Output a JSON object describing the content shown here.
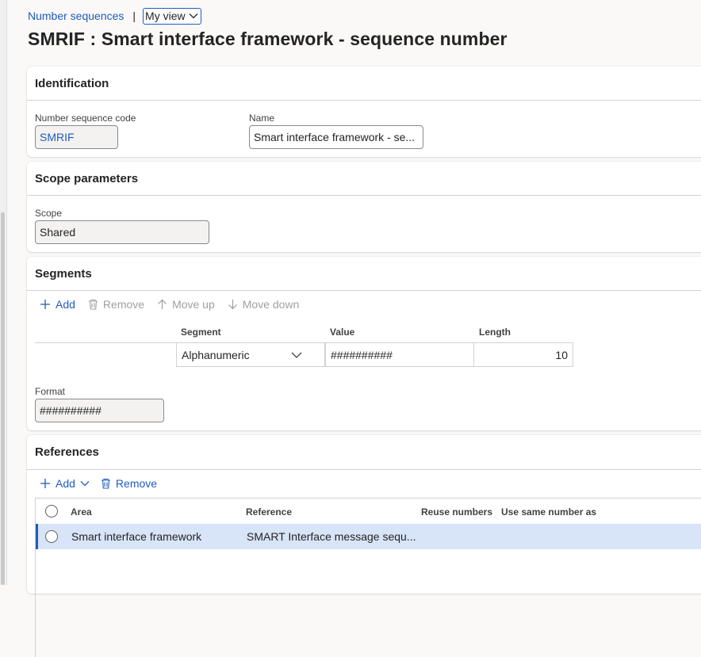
{
  "breadcrumb": {
    "link": "Number sequences",
    "separator": "|",
    "view": "My view"
  },
  "title": "SMRIF : Smart interface framework - sequence number",
  "identification": {
    "header": "Identification",
    "code_label": "Number sequence code",
    "code_value": "SMRIF",
    "name_label": "Name",
    "name_value": "Smart interface framework - se..."
  },
  "scope": {
    "header": "Scope parameters",
    "label": "Scope",
    "value": "Shared"
  },
  "segments": {
    "header": "Segments",
    "toolbar": {
      "add": "Add",
      "remove": "Remove",
      "move_up": "Move up",
      "move_down": "Move down"
    },
    "columns": {
      "segment": "Segment",
      "value": "Value",
      "length": "Length"
    },
    "row": {
      "segment": "Alphanumeric",
      "value": "##########",
      "length": "10"
    },
    "format_label": "Format",
    "format_value": "##########"
  },
  "references": {
    "header": "References",
    "toolbar": {
      "add": "Add",
      "remove": "Remove"
    },
    "columns": {
      "area": "Area",
      "reference": "Reference",
      "reuse": "Reuse numbers",
      "same_as": "Use same number as"
    },
    "rows": [
      {
        "area": "Smart interface framework",
        "reference": "SMART Interface message sequ..."
      }
    ]
  },
  "colors": {
    "accent": "#1e5bbf",
    "selected_row": "#d8e4f7"
  }
}
